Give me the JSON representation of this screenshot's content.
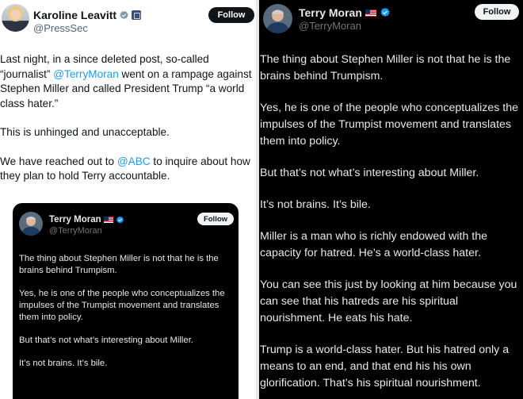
{
  "left_tweet": {
    "author_name": "Karoline Leavitt",
    "handle": "@PressSec",
    "follow_label": "Follow",
    "paragraphs": [
      {
        "pre": "Last night, in a since deleted post, so-called “journalist” ",
        "mention": "@TerryMoran",
        "post": " went on a rampage against Stephen Miller and called President Trump “a world class hater.”"
      },
      {
        "pre": "This is unhinged and unacceptable.",
        "mention": "",
        "post": ""
      },
      {
        "pre": "We have reached out to ",
        "mention": "@ABC",
        "post": " to inquire about how they plan to hold Terry accountable."
      }
    ]
  },
  "embedded_tweet": {
    "author_name": "Terry Moran",
    "handle": "@TerryMoran",
    "follow_label": "Follow",
    "paragraphs": [
      "The thing about Stephen Miller is not that he is the brains behind Trumpism.",
      "Yes, he is one of the people who conceptualizes the impulses of the Trumpist movement and translates them into policy.",
      "But that’s not what’s interesting about Miller.",
      "It’s not brains. It’s bile."
    ]
  },
  "right_tweet": {
    "author_name": "Terry Moran",
    "handle": "@TerryMoran",
    "follow_label": "Follow",
    "paragraphs": [
      "The thing about Stephen Miller is not that he is the brains behind Trumpism.",
      "Yes, he is one of the people who conceptualizes the impulses of the Trumpist movement and translates them into policy.",
      "But that’s not what’s interesting about Miller.",
      "It’s not brains. It’s bile.",
      "Miller is a man who is richly endowed with the capacity for hatred. He’s a world-class hater.",
      "You can see this just by looking at him because you can see that his hatreds are his spiritual nourishment. He eats his hate.",
      "Trump is a world-class hater. But his hatred only a means to an end, and that end his his own glorification. That’s his spiritual nourishment."
    ]
  },
  "icons": {
    "verified": "verified-badge-icon",
    "government": "government-badge-icon",
    "flag": "us-flag-icon"
  },
  "colors": {
    "link": "#1d9bf0",
    "verified": "#1d9bf0",
    "dark_bg": "#000000",
    "light_bg": "#ffffff"
  }
}
